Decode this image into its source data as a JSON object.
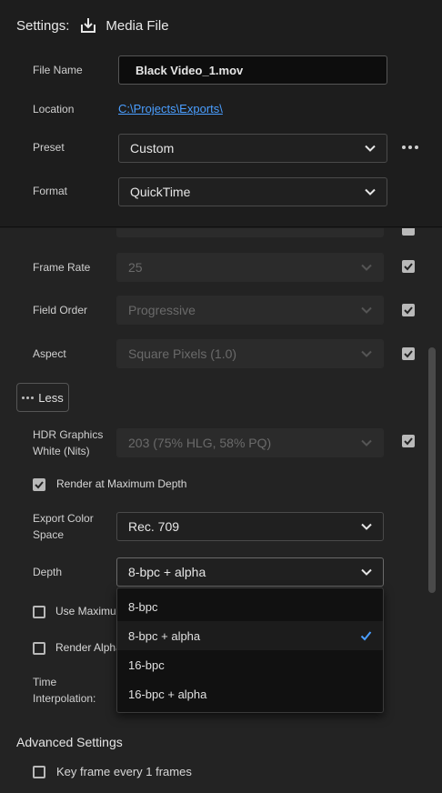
{
  "header": {
    "title": "Settings:",
    "destination": "Media File"
  },
  "file_name": {
    "label": "File Name",
    "value": "Black Video_1.mov"
  },
  "location": {
    "label": "Location",
    "value": "C:\\Projects\\Exports\\"
  },
  "preset": {
    "label": "Preset",
    "value": "Custom"
  },
  "format": {
    "label": "Format",
    "value": "QuickTime"
  },
  "video": {
    "frame_rate": {
      "label": "Frame Rate",
      "value": "25",
      "checked": true
    },
    "field_order": {
      "label": "Field Order",
      "value": "Progressive",
      "checked": true
    },
    "aspect": {
      "label": "Aspect",
      "value": "Square Pixels (1.0)",
      "checked": true
    },
    "less_button": "Less",
    "hdr_white": {
      "label_line1": "HDR Graphics",
      "label_line2": "White (Nits)",
      "value": "203 (75% HLG, 58% PQ)",
      "checked": true
    },
    "render_max_depth": {
      "label": "Render at Maximum Depth",
      "checked": true
    },
    "export_color_space": {
      "label_line1": "Export Color",
      "label_line2": "Space",
      "value": "Rec. 709"
    },
    "depth": {
      "label": "Depth",
      "value": "8-bpc + alpha"
    },
    "use_maximum": {
      "label": "Use Maximum",
      "checked": false
    },
    "render_alpha": {
      "label": "Render Alpha",
      "checked": false
    },
    "time_interpolation": {
      "label_line1": "Time",
      "label_line2": "Interpolation:"
    }
  },
  "depth_dropdown": {
    "options": [
      "8-bpc",
      "8-bpc + alpha",
      "16-bpc",
      "16-bpc + alpha"
    ],
    "selected": "8-bpc + alpha"
  },
  "advanced": {
    "title": "Advanced Settings",
    "keyframe": {
      "label": "Key frame every 1 frames",
      "checked": false
    }
  },
  "colors": {
    "link": "#4a9eff",
    "check_accent": "#4a9eff",
    "background": "#232323"
  }
}
